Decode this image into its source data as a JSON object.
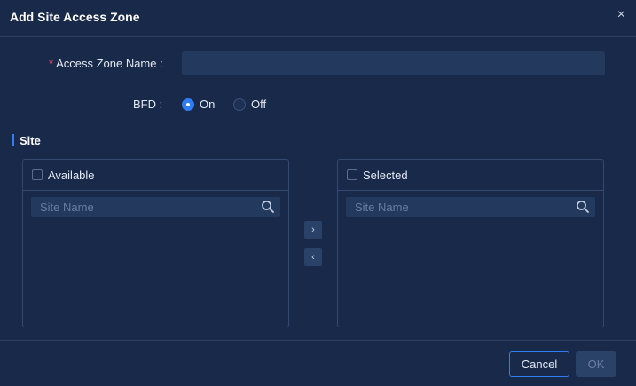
{
  "dialog": {
    "title": "Add Site Access Zone",
    "close_symbol": "×"
  },
  "form": {
    "zone_name_label": "Access Zone Name :",
    "zone_name_value": "",
    "required_mark": "*",
    "bfd_label": "BFD :",
    "bfd_options": [
      {
        "label": "On",
        "checked": true
      },
      {
        "label": "Off",
        "checked": false
      }
    ]
  },
  "site": {
    "section_title": "Site",
    "available": {
      "title": "Available",
      "search_placeholder": "Site Name",
      "items": []
    },
    "selected": {
      "title": "Selected",
      "search_placeholder": "Site Name",
      "items": []
    },
    "move_right_symbol": "›",
    "move_left_symbol": "‹"
  },
  "footer": {
    "cancel_label": "Cancel",
    "ok_label": "OK"
  },
  "colors": {
    "background": "#18294a",
    "accent": "#2f7df6",
    "required": "#ff4d5e",
    "input_bg": "#233a5e"
  }
}
